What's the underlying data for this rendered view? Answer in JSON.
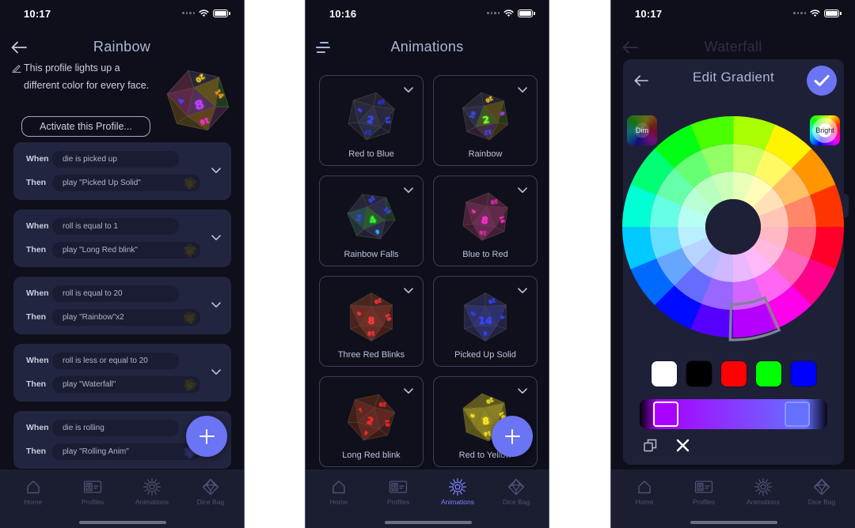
{
  "colors": {
    "accent": "#6b74f2",
    "background": "#0f0f1b",
    "card": "#22253f",
    "tab_active": "#7d84ff",
    "tab_inactive": "#4d5372"
  },
  "tab_bar": {
    "items": [
      {
        "label": "Home",
        "icon": "home-icon"
      },
      {
        "label": "Profiles",
        "icon": "profiles-icon"
      },
      {
        "label": "Animations",
        "icon": "animations-icon"
      },
      {
        "label": "Dice Bag",
        "icon": "dice-bag-icon"
      }
    ]
  },
  "profile_screen": {
    "status_time": "10:17",
    "back_icon": "back-arrow-icon",
    "title": "Rainbow",
    "edit_icon": "pencil-icon",
    "description": "This profile lights up a different color for every face.",
    "activate_button": "Activate this Profile...",
    "die": {
      "glow": [
        "#c040ff",
        "#ffd21a",
        "#ff9a1a",
        "#ff30d0",
        "#3f4dff",
        "#2aff3a"
      ],
      "numbers": [
        "8",
        "20",
        "14",
        "16",
        "4"
      ],
      "intensity": 0.25
    },
    "rule_labels": {
      "when": "When",
      "then": "Then"
    },
    "rules": [
      {
        "when": "die is picked up",
        "then": "play \"Picked Up Solid\"",
        "thumb": {
          "glow": [
            "#6b6b45"
          ],
          "numbers": [],
          "intensity": 0.15
        }
      },
      {
        "when": "roll is equal to 1",
        "then": "play \"Long Red blink\"",
        "thumb": {
          "glow": [
            "#6b6b45"
          ],
          "numbers": [],
          "intensity": 0.15
        }
      },
      {
        "when": "roll is equal to 20",
        "then": "play \"Rainbow\"x2",
        "thumb": {
          "glow": [
            "#6b6b45"
          ],
          "numbers": [],
          "intensity": 0.15
        }
      },
      {
        "when": "roll is less or equal to 20",
        "then": "play \"Waterfall\"",
        "thumb": {
          "glow": [
            "#6b6b45"
          ],
          "numbers": [],
          "intensity": 0.15
        }
      },
      {
        "when": "die is rolling",
        "then": "play \"Rolling Anim\"",
        "thumb": {
          "glow": [
            "#3040ff"
          ],
          "numbers": [],
          "intensity": 0.35
        }
      }
    ],
    "fab_icon": "plus-icon",
    "active_tab": null
  },
  "animations_screen": {
    "status_time": "10:16",
    "menu_icon": "hamburger-menu-icon",
    "title": "Animations",
    "items": [
      {
        "name": "Red to Blue",
        "glow": [
          "#3a46ff",
          "#2a36e0"
        ],
        "numbers": [
          "2",
          "20",
          "12",
          "17",
          "5"
        ],
        "intensity": 0.18
      },
      {
        "name": "Rainbow",
        "glow": [
          "#7cff2a",
          "#ffd21a",
          "#b040ff",
          "#3f4dff",
          "#3f4dff"
        ],
        "numbers": [
          "2",
          "20",
          "8",
          "12",
          "10"
        ],
        "intensity": 0.2
      },
      {
        "name": "Rainbow Falls",
        "glow": [
          "#28ff3a",
          "#3a44ff",
          "#3a44ff",
          "#20d0ff",
          "#3a44ff"
        ],
        "numbers": [
          "4",
          "20",
          "18",
          "6",
          "14"
        ],
        "intensity": 0.22
      },
      {
        "name": "Blue to Red",
        "glow": [
          "#ff2fd0",
          "#e52fb0"
        ],
        "numbers": [
          "8",
          "20",
          "14",
          "16",
          "4"
        ],
        "intensity": 0.3
      },
      {
        "name": "Three Red Blinks",
        "glow": [
          "#ff3a3a"
        ],
        "numbers": [
          "8",
          "20",
          "16",
          "10",
          "4"
        ],
        "intensity": 0.3
      },
      {
        "name": "Picked Up Solid",
        "glow": [
          "#3444ff"
        ],
        "numbers": [
          "14",
          "20",
          "4",
          "6",
          "2"
        ],
        "intensity": 0.35
      },
      {
        "name": "Long Red blink",
        "glow": [
          "#ff2a2a"
        ],
        "numbers": [
          "2",
          "20",
          "18",
          "4",
          "7"
        ],
        "intensity": 0.25
      },
      {
        "name": "Red to Yellow",
        "glow": [
          "#ffee2a"
        ],
        "numbers": [
          "8",
          "20",
          "16",
          "14",
          "6"
        ],
        "intensity": 0.45
      }
    ],
    "card_menu_icon": "chevron-down-icon",
    "fab_icon": "plus-icon",
    "active_tab": "Animations"
  },
  "gradient_screen": {
    "status_time": "10:17",
    "background_title": "Waterfall",
    "active_tab": null,
    "modal": {
      "title": "Edit Gradient",
      "confirm_icon": "check-icon",
      "dim_label": "Dim",
      "bright_label": "Bright",
      "wheel": {
        "hues": [
          80,
          57.5,
          35,
          12.5,
          350,
          327.5,
          305,
          282.5,
          260,
          237.5,
          215,
          192.5,
          170,
          147.5,
          125,
          102.5
        ],
        "ring_lightness": [
          50,
          70,
          86
        ],
        "selected": {
          "segment": 7,
          "ring": 0
        }
      },
      "swatches": [
        "#ffffff",
        "#000000",
        "#ff0000",
        "#00ff00",
        "#0000ff"
      ],
      "gradient_stops": [
        {
          "position": 0.14,
          "color": "#aa00ff",
          "selected": true
        },
        {
          "position": 0.84,
          "color": "#6670ff",
          "selected": false
        }
      ],
      "actions": [
        {
          "icon": "duplicate-icon"
        },
        {
          "icon": "delete-x-icon"
        }
      ]
    }
  }
}
